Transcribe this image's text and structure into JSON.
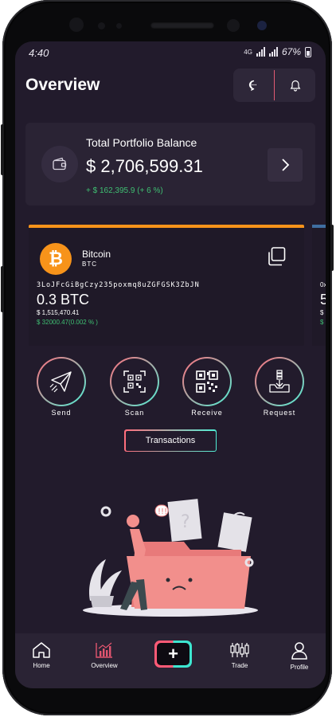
{
  "status_bar": {
    "time": "4:40",
    "battery": "67%"
  },
  "header": {
    "title": "Overview",
    "icons": [
      "chat-icon",
      "bell-icon"
    ]
  },
  "portfolio": {
    "label": "Total Portfolio Balance",
    "value": "$ 2,706,599.31",
    "change": "+ $ 162,395.9 (+ 6 %)"
  },
  "wallet_card": {
    "accent": "#f7931a",
    "coin_name": "Bitcoin",
    "coin_symbol": "BTC",
    "address": "3LoJFcGiBgCzy235poxmq8uZGFGSK3ZbJN",
    "amount": "0.3 BTC",
    "fiat_value": "$ 1,515,470.41",
    "price_change": "$ 32000.47(0.002 % )"
  },
  "next_card_peek": {
    "accent": "#3f6ea1",
    "line1": "0x",
    "line2": "5",
    "line3": "$",
    "line4": "$"
  },
  "actions": [
    {
      "label": "Send",
      "icon": "send-icon"
    },
    {
      "label": "Scan",
      "icon": "qr-scan-icon"
    },
    {
      "label": "Receive",
      "icon": "qr-code-icon"
    },
    {
      "label": "Request",
      "icon": "request-icon"
    }
  ],
  "transactions_button": "Transactions",
  "bottom_nav": [
    {
      "label": "Home",
      "icon": "home-icon",
      "active": false
    },
    {
      "label": "Overview",
      "icon": "chart-icon",
      "active": true
    },
    {
      "label": "",
      "icon": "plus-icon",
      "active": false
    },
    {
      "label": "Trade",
      "icon": "candlestick-icon",
      "active": false
    },
    {
      "label": "Profile",
      "icon": "user-icon",
      "active": false
    }
  ],
  "colors": {
    "background": "#221b2c",
    "card": "#2a2334",
    "positive": "#3fbf72",
    "gradient_start": "#ff6d7c",
    "gradient_end": "#4ff0d6"
  }
}
